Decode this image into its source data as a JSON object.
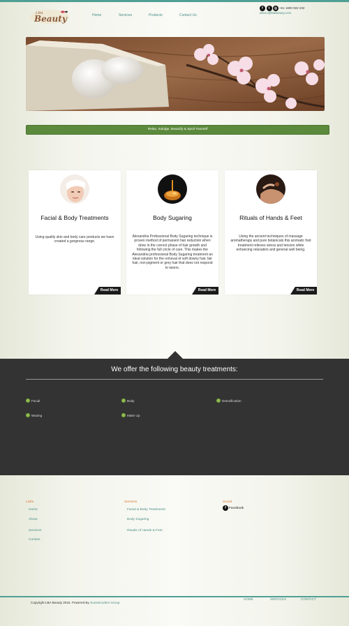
{
  "header": {
    "logo_text": "Beauty",
    "logo_prefix": "LBA",
    "nav": [
      "Home",
      "Services",
      "Products",
      "Contact Us"
    ],
    "phone": "+61 1800 922 232",
    "email": "alison@lbabeauty.com"
  },
  "hero": {
    "tagline": "Relax, Indulge, Beautify & Spoil Yourself"
  },
  "cards": [
    {
      "title": "Facial & Body Treatments",
      "body": "Using quality skin and body care products we have created a gorgeous range.",
      "button": "Read More"
    },
    {
      "title": "Body Sugaring",
      "body": "Alexandria Professional Body Sugaring technique is proven method of permanent hair reduction when done in the correct phase of hair growth and following the full circle of care. This makes the Alexandria professional Body Sugaring treatment an ideal solution for the removal of soft downy hair, fair hair, non-pigment or grey hair that does not respond to lasers.",
      "button": "Read More"
    },
    {
      "title": "Rituals of Hands & Feet",
      "body": "Using the ancient techniques of massage aromatherapy and pure botanicals this aromatic foot treatment relieves stress and tension while enhancing relaxation and general well being.",
      "button": "Read More"
    }
  ],
  "treatments": {
    "heading": "We offer the following beauty treatments:",
    "items": [
      "Facial",
      "Body",
      "Detoxification",
      "Waxing",
      "Make Up"
    ]
  },
  "footer": {
    "links_title": "Links",
    "links": [
      "Home",
      "About",
      "Services",
      "Contact"
    ],
    "services_title": "Services",
    "services": [
      "Facial & Body Treatments",
      "Body Sugaring",
      "Rituals of Hands & Feet"
    ],
    "social_title": "Social",
    "social_facebook": "Facebook",
    "copyright": "Copyright LBA Beauty 2016. Powered By ",
    "powered_by": "Sunsetcoders Group.",
    "bottom_nav": [
      "HOME",
      "SERVICES",
      "CONTACT"
    ]
  },
  "colors": {
    "accent_teal": "#4f9f94",
    "tagline_green": "#5b8a3c",
    "dark_section": "#333333",
    "footer_title_orange": "#d6762e",
    "check_green": "#7fb03c"
  },
  "icons": {
    "social": [
      "facebook-icon",
      "twitter-icon",
      "instagram-icon"
    ],
    "treatment_bullet": "check-circle-icon"
  }
}
